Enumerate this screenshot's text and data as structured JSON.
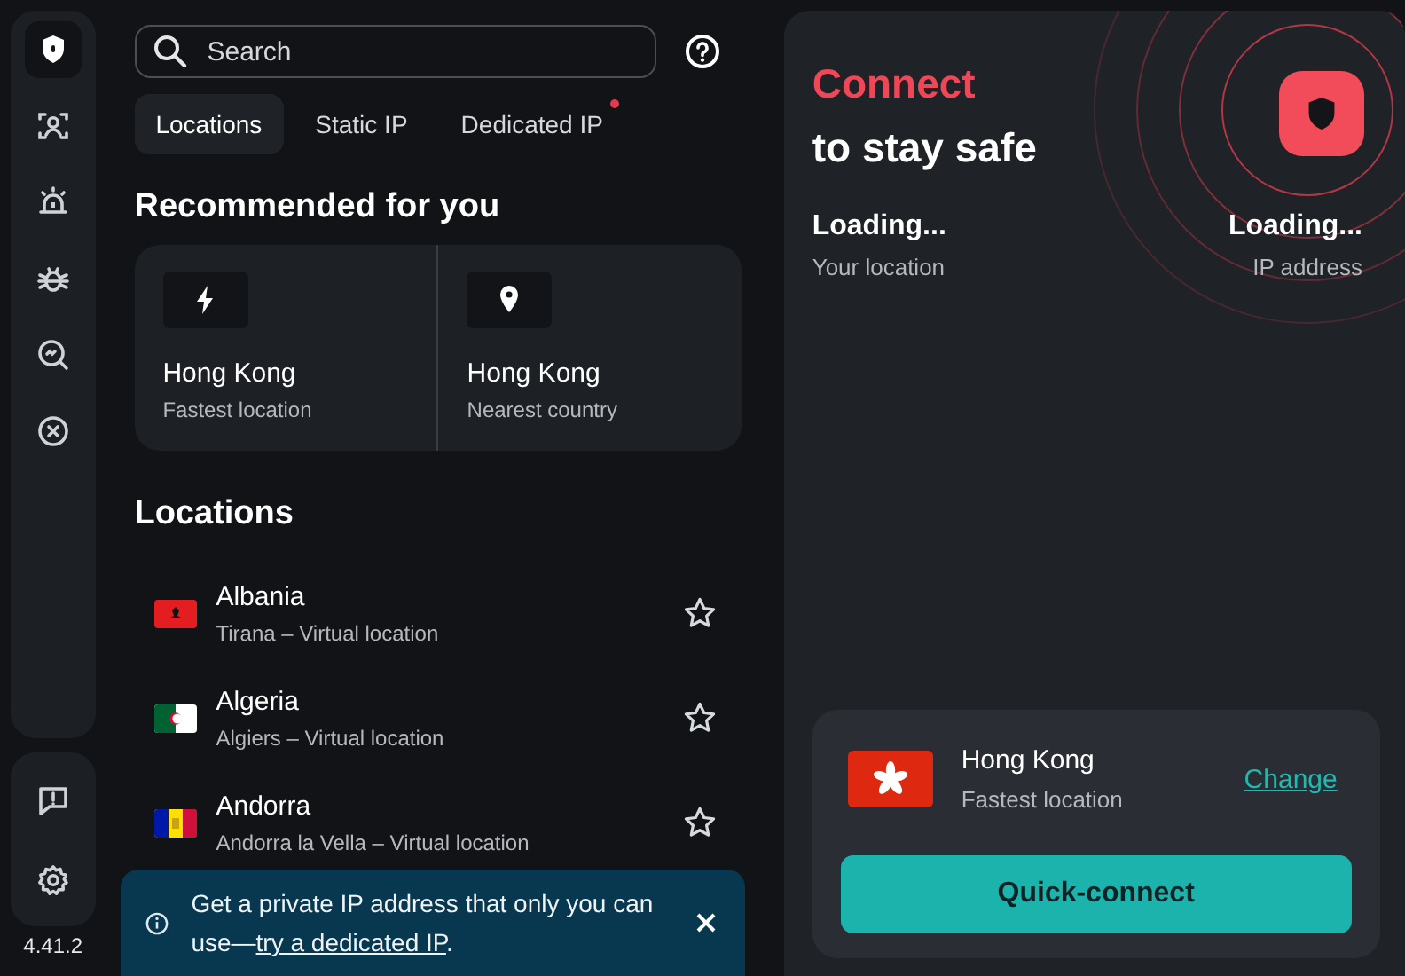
{
  "sidebar": {
    "items": [
      {
        "kind": "shield",
        "selected": true
      },
      {
        "kind": "person",
        "selected": false
      },
      {
        "kind": "alarm",
        "selected": false
      },
      {
        "kind": "bug",
        "selected": false
      },
      {
        "kind": "scan",
        "selected": false
      },
      {
        "kind": "block",
        "selected": false
      }
    ],
    "bottom_items": [
      {
        "kind": "feedback"
      },
      {
        "kind": "settings"
      }
    ],
    "version": "4.41.2"
  },
  "search": {
    "placeholder": "Search"
  },
  "tabs": [
    {
      "label": "Locations",
      "selected": true,
      "notification": false
    },
    {
      "label": "Static IP",
      "selected": false,
      "notification": false
    },
    {
      "label": "Dedicated IP",
      "selected": false,
      "notification": true
    }
  ],
  "recommended": {
    "title": "Recommended for you",
    "cards": [
      {
        "kind": "bolt",
        "name": "Hong Kong",
        "detail": "Fastest location"
      },
      {
        "kind": "pin",
        "name": "Hong Kong",
        "detail": "Nearest country"
      }
    ]
  },
  "locations": {
    "title": "Locations",
    "items": [
      {
        "name": "Albania",
        "detail": "Tirana – Virtual location",
        "favorite": false
      },
      {
        "name": "Algeria",
        "detail": "Algiers – Virtual location",
        "favorite": false
      },
      {
        "name": "Andorra",
        "detail": "Andorra la Vella – Virtual location",
        "favorite": false
      }
    ]
  },
  "banner": {
    "text": "Get a private IP address that only you can use—",
    "link": "try a dedicated IP",
    "end": "."
  },
  "status": {
    "headline": "Connect",
    "subline": "to stay safe",
    "connected": false,
    "location_value": "Loading...",
    "location_label": "Your location",
    "ip_value": "Loading...",
    "ip_label": "IP address"
  },
  "quick": {
    "name": "Hong Kong",
    "detail": "Fastest location",
    "change": "Change",
    "button": "Quick-connect"
  }
}
